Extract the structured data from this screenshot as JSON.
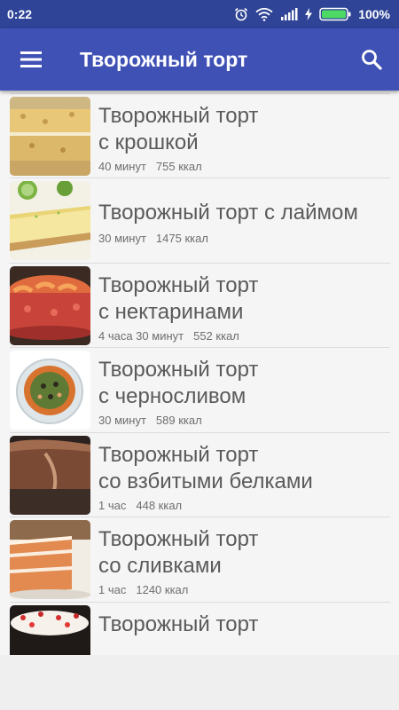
{
  "status": {
    "time": "0:22",
    "battery": "100%"
  },
  "appbar": {
    "title": "Творожный торт"
  },
  "recipes": [
    {
      "name": "",
      "time": "",
      "kcal": ""
    },
    {
      "name": "Творожный торт\nс крошкой",
      "time": "40 минут",
      "kcal": "755 ккал"
    },
    {
      "name": "Творожный торт с лаймом",
      "time": "30 минут",
      "kcal": "1475 ккал"
    },
    {
      "name": "Творожный торт\nс нектаринами",
      "time": "4 часа 30 минут",
      "kcal": "552 ккал"
    },
    {
      "name": "Творожный торт\nс черносливом",
      "time": "30 минут",
      "kcal": "589 ккал"
    },
    {
      "name": "Творожный торт\nсо взбитыми белками",
      "time": "1 час",
      "kcal": "448 ккал"
    },
    {
      "name": "Творожный торт\nсо сливками",
      "time": "1 час",
      "kcal": "1240 ккал"
    },
    {
      "name": "Творожный торт",
      "time": "",
      "kcal": ""
    }
  ],
  "icons": {
    "menu": "hamburger-menu-icon",
    "search": "search-icon",
    "alarm": "alarm-icon",
    "wifi": "wifi-icon",
    "signal": "signal-icon",
    "battery": "battery-charging-icon"
  },
  "colors": {
    "statusbar": "#2f4496",
    "appbar": "#3f51b5",
    "battery": "#4cd964"
  }
}
